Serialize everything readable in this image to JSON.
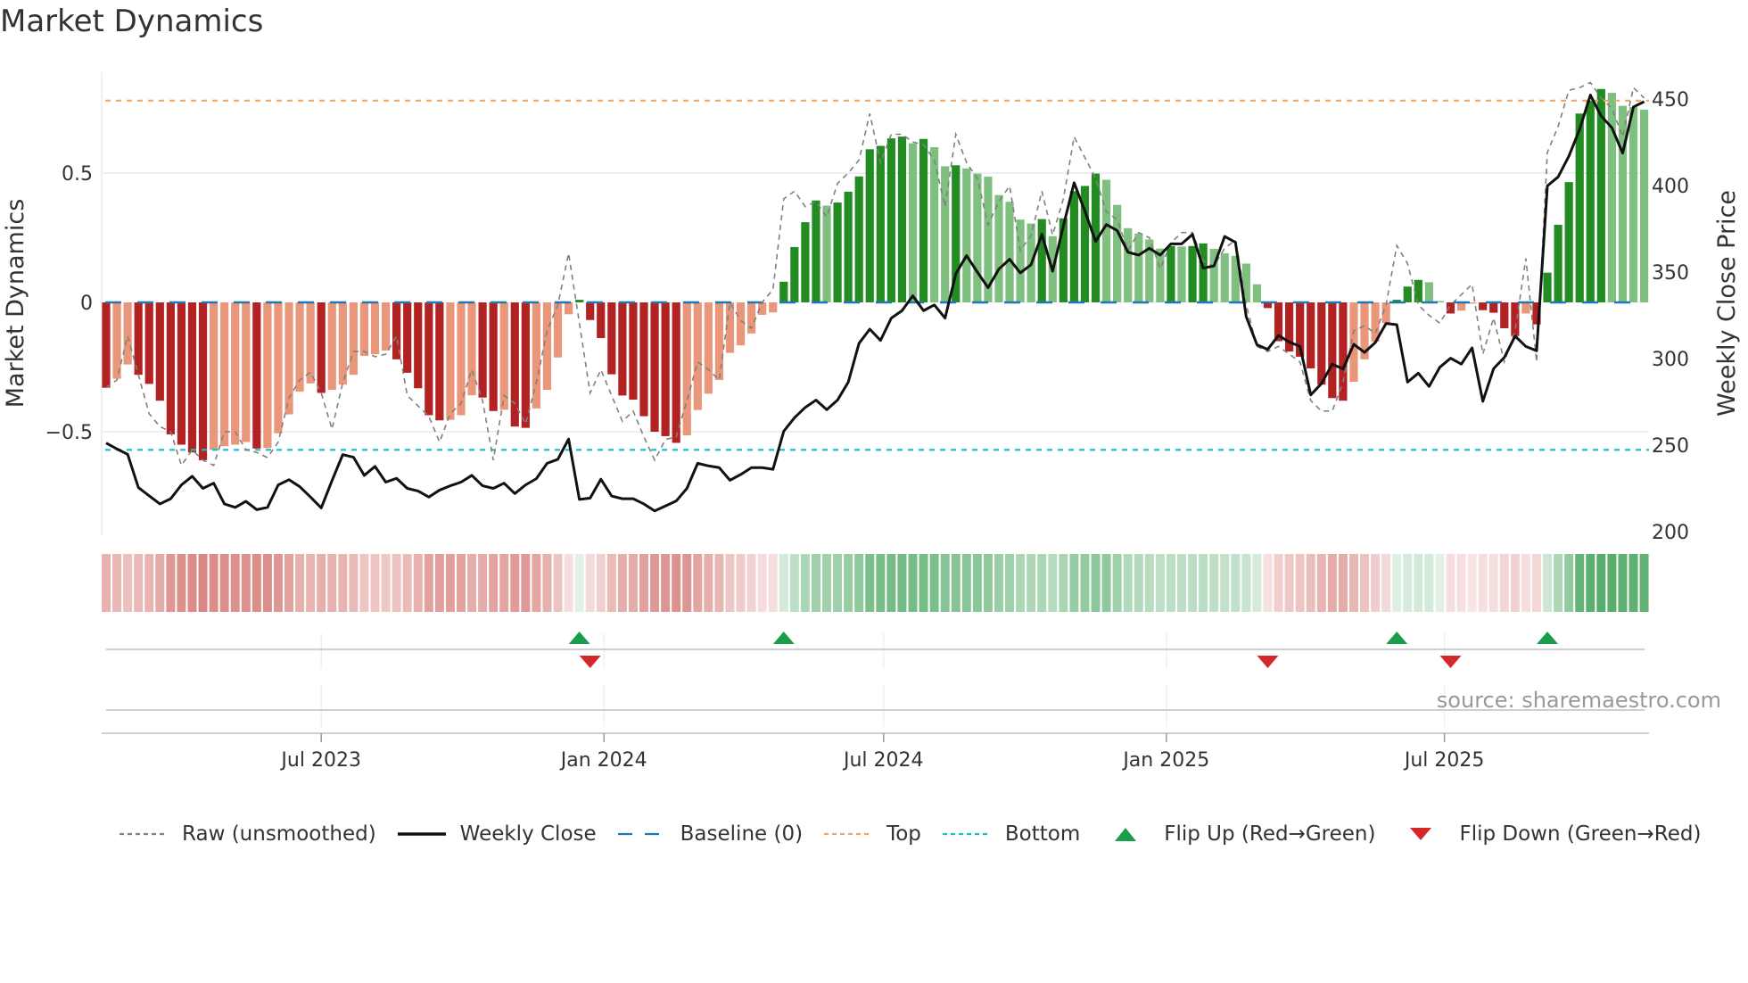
{
  "title": "Market Dynamics",
  "source": "source: sharemaestro.com",
  "colors": {
    "bar_red_dark": "#b22222",
    "bar_red_light": "#e9967a",
    "bar_green_dark": "#228b22",
    "bar_green_light": "#7fbf7f",
    "heat_red": "#c8504a",
    "heat_green": "#3a9f52",
    "raw": "#808080",
    "close": "#111111",
    "baseline": "#1f77b4",
    "top": "#f4a460",
    "bottom": "#17becf",
    "flip_up": "#1a9e4a",
    "flip_down": "#d62728"
  },
  "legend": [
    {
      "key": "raw",
      "label": "Raw (unsmoothed)"
    },
    {
      "key": "close",
      "label": "Weekly Close"
    },
    {
      "key": "baseline",
      "label": "Baseline (0)"
    },
    {
      "key": "top",
      "label": "Top"
    },
    {
      "key": "bottom",
      "label": "Bottom"
    },
    {
      "key": "flip_up",
      "label": "Flip Up (Red→Green)"
    },
    {
      "key": "flip_down",
      "label": "Flip Down (Green→Red)"
    }
  ],
  "chart_data": {
    "type": "bar",
    "title": "Market Dynamics",
    "frequency": "weekly",
    "start_date": "2023-02-11",
    "ylabel_left": "Market Dynamics",
    "ylabel_right": "Weekly Close Price",
    "left_ylim": [
      -0.9,
      0.89
    ],
    "right_ylim": [
      198,
      465
    ],
    "grid": true,
    "legend_position": "bottom",
    "left_ticks": [
      {
        "value": 0.5,
        "label": "0.5"
      },
      {
        "value": 0,
        "label": "0"
      },
      {
        "value": -0.5,
        "label": "−0.5"
      }
    ],
    "right_ticks": [
      {
        "value": 450,
        "label": "450"
      },
      {
        "value": 400,
        "label": "400"
      },
      {
        "value": 350,
        "label": "350"
      },
      {
        "value": 300,
        "label": "300"
      },
      {
        "value": 250,
        "label": "250"
      },
      {
        "value": 200,
        "label": "200"
      }
    ],
    "x_ticks": [
      {
        "date": "2023-07-01",
        "label": "Jul 2023"
      },
      {
        "date": "2024-01-01",
        "label": "Jan 2024"
      },
      {
        "date": "2024-07-01",
        "label": "Jul 2024"
      },
      {
        "date": "2025-01-01",
        "label": "Jan 2025"
      },
      {
        "date": "2025-07-01",
        "label": "Jul 2025"
      }
    ],
    "top_level": 0.78,
    "bottom_level": -0.57,
    "baseline": 0,
    "series": [
      {
        "name": "Market Dynamics",
        "values": [
          -0.33,
          -0.295,
          -0.24,
          -0.28,
          -0.315,
          -0.38,
          -0.51,
          -0.55,
          -0.58,
          -0.61,
          -0.57,
          -0.556,
          -0.55,
          -0.54,
          -0.565,
          -0.563,
          -0.506,
          -0.433,
          -0.345,
          -0.313,
          -0.35,
          -0.338,
          -0.318,
          -0.28,
          -0.207,
          -0.2,
          -0.186,
          -0.22,
          -0.272,
          -0.332,
          -0.436,
          -0.456,
          -0.454,
          -0.436,
          -0.359,
          -0.368,
          -0.42,
          -0.415,
          -0.48,
          -0.485,
          -0.41,
          -0.338,
          -0.213,
          -0.046,
          0.01,
          -0.068,
          -0.138,
          -0.278,
          -0.36,
          -0.376,
          -0.44,
          -0.5,
          -0.517,
          -0.543,
          -0.514,
          -0.416,
          -0.353,
          -0.3,
          -0.195,
          -0.166,
          -0.12,
          -0.048,
          -0.039,
          0.08,
          0.214,
          0.31,
          0.394,
          0.374,
          0.386,
          0.428,
          0.487,
          0.592,
          0.605,
          0.634,
          0.641,
          0.615,
          0.632,
          0.6,
          0.526,
          0.53,
          0.518,
          0.498,
          0.486,
          0.415,
          0.389,
          0.32,
          0.305,
          0.322,
          0.256,
          0.325,
          0.43,
          0.45,
          0.498,
          0.474,
          0.377,
          0.287,
          0.266,
          0.243,
          0.208,
          0.218,
          0.216,
          0.218,
          0.228,
          0.207,
          0.19,
          0.18,
          0.15,
          0.07,
          -0.022,
          -0.15,
          -0.19,
          -0.21,
          -0.255,
          -0.318,
          -0.37,
          -0.38,
          -0.307,
          -0.22,
          -0.152,
          -0.08,
          0.01,
          0.061,
          0.087,
          0.078,
          0.005,
          -0.043,
          -0.032,
          -0.005,
          -0.03,
          -0.04,
          -0.1,
          -0.13,
          -0.043,
          -0.085,
          0.115,
          0.3,
          0.465,
          0.73,
          0.78,
          0.825,
          0.81,
          0.76,
          0.755,
          0.745
        ]
      },
      {
        "name": "Raw (unsmoothed)",
        "values": [
          -0.33,
          -0.3,
          -0.13,
          -0.28,
          -0.43,
          -0.48,
          -0.5,
          -0.63,
          -0.57,
          -0.61,
          -0.63,
          -0.5,
          -0.5,
          -0.57,
          -0.58,
          -0.6,
          -0.54,
          -0.37,
          -0.3,
          -0.27,
          -0.35,
          -0.49,
          -0.31,
          -0.19,
          -0.19,
          -0.21,
          -0.2,
          -0.13,
          -0.36,
          -0.4,
          -0.44,
          -0.54,
          -0.43,
          -0.39,
          -0.26,
          -0.38,
          -0.61,
          -0.36,
          -0.39,
          -0.47,
          -0.31,
          -0.11,
          -0.01,
          0.19,
          -0.08,
          -0.35,
          -0.26,
          -0.36,
          -0.46,
          -0.42,
          -0.52,
          -0.61,
          -0.53,
          -0.52,
          -0.38,
          -0.23,
          -0.26,
          -0.3,
          0,
          -0.07,
          -0.1,
          0,
          0.05,
          0.4,
          0.43,
          0.37,
          0.39,
          0.33,
          0.46,
          0.5,
          0.55,
          0.73,
          0.54,
          0.65,
          0.65,
          0.62,
          0.61,
          0.55,
          0.37,
          0.65,
          0.54,
          0.48,
          0.3,
          0.39,
          0.45,
          0.2,
          0.26,
          0.43,
          0.26,
          0.4,
          0.64,
          0.56,
          0.48,
          0.35,
          0.32,
          0.2,
          0.27,
          0.25,
          0.13,
          0.23,
          0.27,
          0.27,
          0.16,
          0.14,
          0.21,
          0.24,
          -0.01,
          -0.17,
          -0.19,
          -0.17,
          -0.2,
          -0.23,
          -0.38,
          -0.42,
          -0.42,
          -0.31,
          -0.11,
          -0.09,
          -0.12,
          -0.01,
          0.22,
          0.15,
          -0.01,
          -0.05,
          -0.08,
          -0.01,
          0.03,
          0.07,
          -0.2,
          -0.06,
          -0.23,
          -0.11,
          0.17,
          -0.23,
          0.58,
          0.68,
          0.82,
          0.83,
          0.85,
          0.79,
          0.75,
          0.64,
          0.83,
          0.79
        ]
      },
      {
        "name": "Weekly Close",
        "axis": "right",
        "values": [
          251.2,
          247.8,
          244.7,
          225.5,
          220.7,
          216,
          219,
          227,
          232,
          225,
          228,
          216,
          214,
          217.5,
          212.7,
          214,
          227,
          230,
          226,
          220,
          213.7,
          229.5,
          244.5,
          243,
          232.5,
          237.7,
          228.6,
          230.8,
          225,
          223.5,
          220,
          224,
          226.5,
          228.6,
          232.5,
          226.5,
          225,
          228,
          222,
          227,
          230.6,
          239.5,
          241.8,
          253.5,
          218.6,
          219.4,
          230.3,
          220.6,
          219,
          219,
          216,
          212,
          214.8,
          217.7,
          225,
          239.5,
          238,
          237,
          229.7,
          233,
          237,
          237,
          236,
          258,
          265.8,
          271.8,
          276,
          270.5,
          276,
          286.4,
          308.8,
          317,
          310.5,
          323.4,
          327.7,
          336.3,
          327.7,
          331,
          323.4,
          349,
          359.5,
          350,
          341,
          351.7,
          357.4,
          349.5,
          354.3,
          371.8,
          350.5,
          376.7,
          401.6,
          385.2,
          367.7,
          377.5,
          374,
          361.5,
          359.8,
          363.8,
          359.8,
          366.3,
          366.3,
          371.8,
          352.3,
          353.5,
          370.6,
          367.2,
          324.2,
          308,
          305.3,
          313.4,
          309.6,
          307,
          279,
          285.6,
          296.8,
          294,
          308.3,
          303.6,
          309.3,
          320.3,
          319.6,
          286.4,
          291.6,
          283.9,
          295,
          300.2,
          296.8,
          306.2,
          275.3,
          294.2,
          300.7,
          313,
          307,
          304.5,
          399.8,
          405,
          417,
          432.5,
          452.3,
          440.2,
          433.4,
          418.7,
          445.4,
          448.5
        ]
      }
    ],
    "flips_up_week": [
      45,
      64,
      121,
      135
    ],
    "flips_down_week": [
      46,
      109,
      126
    ]
  }
}
